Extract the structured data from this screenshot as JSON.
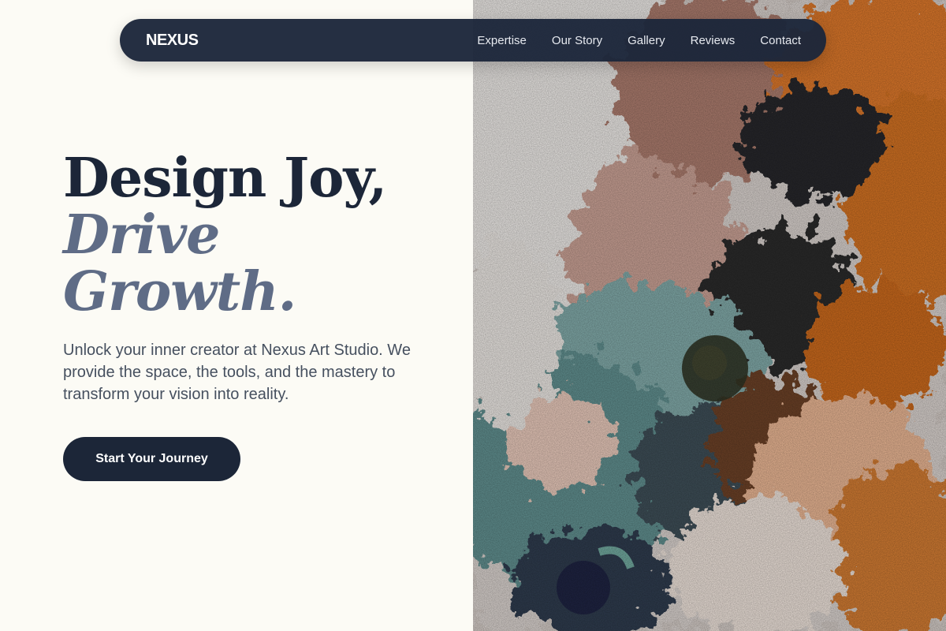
{
  "nav": {
    "logo": "NEXUS",
    "links": [
      "Expertise",
      "Our Story",
      "Gallery",
      "Reviews",
      "Contact"
    ]
  },
  "hero": {
    "title_line1": "Design Joy,",
    "title_line2": "Drive",
    "title_line3": "Growth.",
    "description": "Unlock your inner creator at Nexus Art Studio. We provide the space, the tools, and the mastery to transform your vision into reality.",
    "cta_label": "Start Your Journey"
  },
  "colors": {
    "background": "#fcfbf5",
    "navy": "#1c2638",
    "accent_slate": "#5f6c86",
    "body_text": "#46505f"
  }
}
